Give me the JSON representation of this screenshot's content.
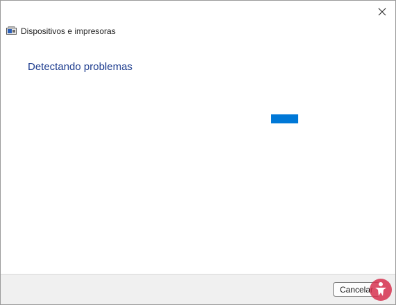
{
  "window": {
    "title": "Dispositivos e impresoras",
    "close_icon": "close-icon"
  },
  "content": {
    "heading": "Detectando problemas",
    "progress_state": "indeterminate"
  },
  "footer": {
    "cancel_label": "Cancelar"
  },
  "colors": {
    "heading": "#1e3d8f",
    "progress": "#0078d7",
    "footer_bg": "#f0f0f0",
    "watermark": "#d6314f"
  }
}
